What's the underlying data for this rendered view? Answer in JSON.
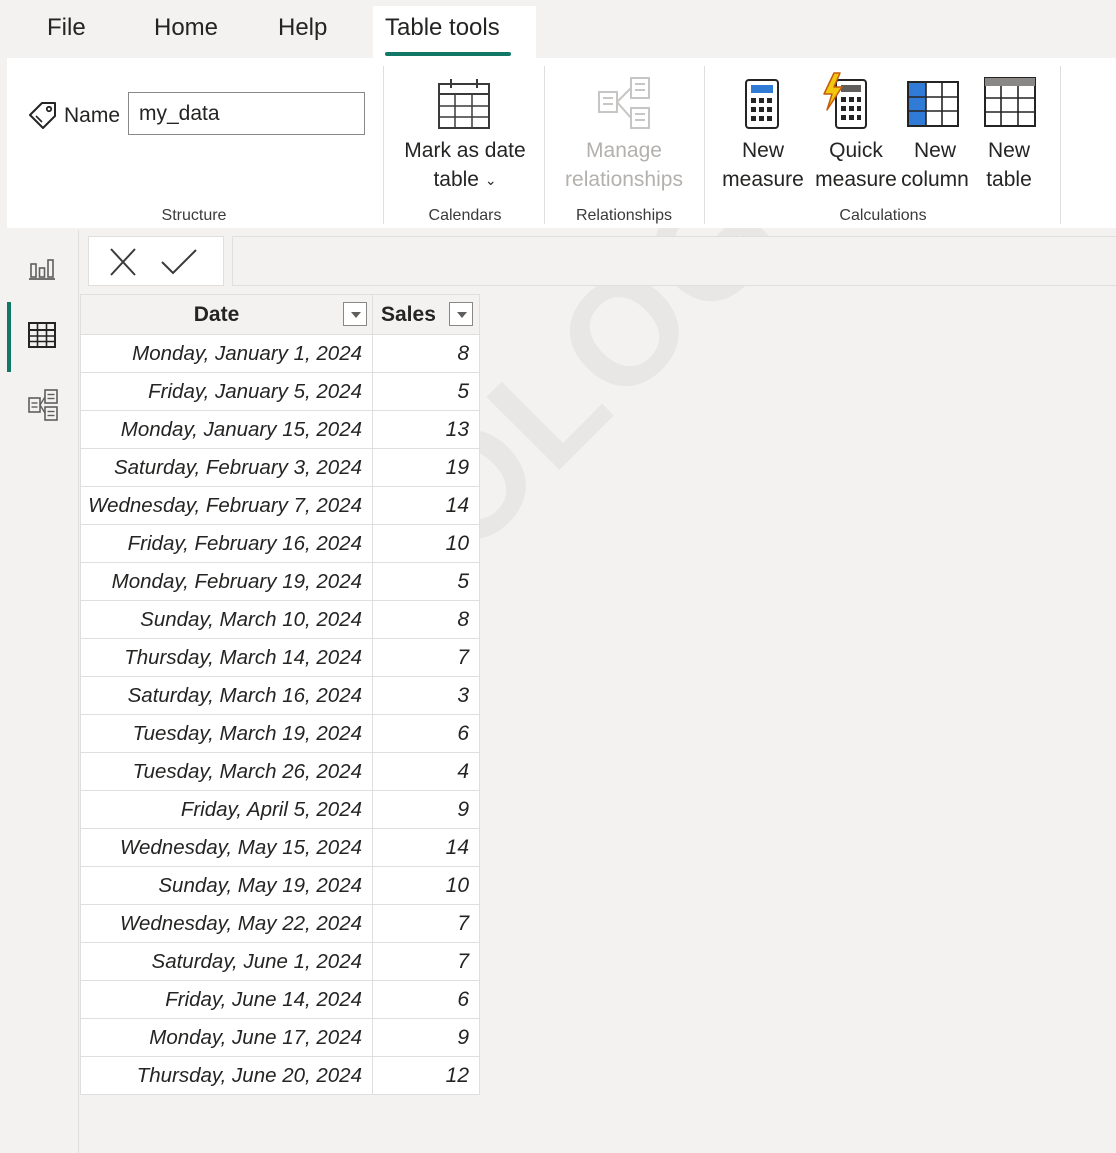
{
  "menu": {
    "tabs": [
      {
        "label": "File"
      },
      {
        "label": "Home"
      },
      {
        "label": "Help"
      },
      {
        "label": "Table tools",
        "active": true
      }
    ]
  },
  "ribbon": {
    "structure": {
      "name_label": "Name",
      "name_value": "my_data",
      "group_label": "Structure"
    },
    "calendars": {
      "mark_as_date_line1": "Mark as date",
      "mark_as_date_line2": "table",
      "group_label": "Calendars"
    },
    "relationships": {
      "manage_line1": "Manage",
      "manage_line2": "relationships",
      "group_label": "Relationships"
    },
    "calculations": {
      "new_measure_line1": "New",
      "new_measure_line2": "measure",
      "quick_measure_line1": "Quick",
      "quick_measure_line2": "measure",
      "new_column_line1": "New",
      "new_column_line2": "column",
      "new_table_line1": "New",
      "new_table_line2": "table",
      "group_label": "Calculations"
    }
  },
  "accent_color": "#117865",
  "table": {
    "columns": [
      "Date",
      "Sales"
    ],
    "rows": [
      {
        "date": "Monday, January 1, 2024",
        "sales": "8"
      },
      {
        "date": "Friday, January 5, 2024",
        "sales": "5"
      },
      {
        "date": "Monday, January 15, 2024",
        "sales": "13"
      },
      {
        "date": "Saturday, February 3, 2024",
        "sales": "19"
      },
      {
        "date": "Wednesday, February 7, 2024",
        "sales": "14"
      },
      {
        "date": "Friday, February 16, 2024",
        "sales": "10"
      },
      {
        "date": "Monday, February 19, 2024",
        "sales": "5"
      },
      {
        "date": "Sunday, March 10, 2024",
        "sales": "8"
      },
      {
        "date": "Thursday, March 14, 2024",
        "sales": "7"
      },
      {
        "date": "Saturday, March 16, 2024",
        "sales": "3"
      },
      {
        "date": "Tuesday, March 19, 2024",
        "sales": "6"
      },
      {
        "date": "Tuesday, March 26, 2024",
        "sales": "4"
      },
      {
        "date": "Friday, April 5, 2024",
        "sales": "9"
      },
      {
        "date": "Wednesday, May 15, 2024",
        "sales": "14"
      },
      {
        "date": "Sunday, May 19, 2024",
        "sales": "10"
      },
      {
        "date": "Wednesday, May 22, 2024",
        "sales": "7"
      },
      {
        "date": "Saturday, June 1, 2024",
        "sales": "7"
      },
      {
        "date": "Friday, June 14, 2024",
        "sales": "6"
      },
      {
        "date": "Monday, June 17, 2024",
        "sales": "9"
      },
      {
        "date": "Thursday, June 20, 2024",
        "sales": "12"
      }
    ]
  },
  "watermark": "STATOLOGY.COM"
}
